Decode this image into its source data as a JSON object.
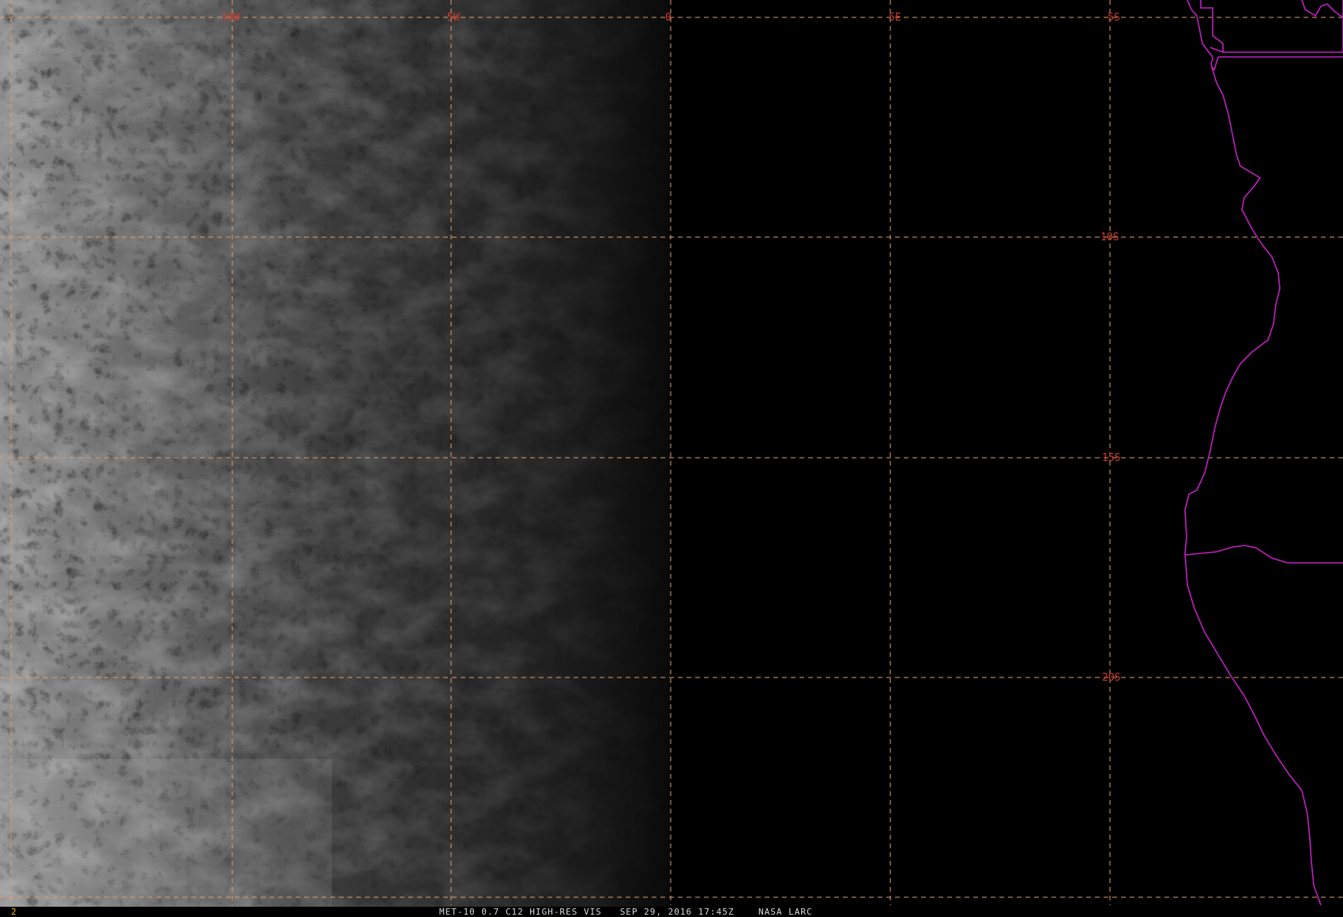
{
  "map": {
    "title": "MET-10 0.7 C12 HIGH-RES VIS",
    "date": "SEP 29, 2016",
    "time": "17:45Z",
    "source": "NASA LARC",
    "frame": "2",
    "longitude_labels": [
      "10W",
      "5W",
      "0",
      "5E"
    ],
    "latitude_labels": [
      "5S",
      "10S",
      "15S",
      "20S"
    ],
    "colors": {
      "grid": "#e0a070",
      "grid_label": "#d23a2a",
      "coastline": "#c020c0",
      "status_text": "#d8d8d8",
      "frame_number": "#e6c800"
    }
  }
}
